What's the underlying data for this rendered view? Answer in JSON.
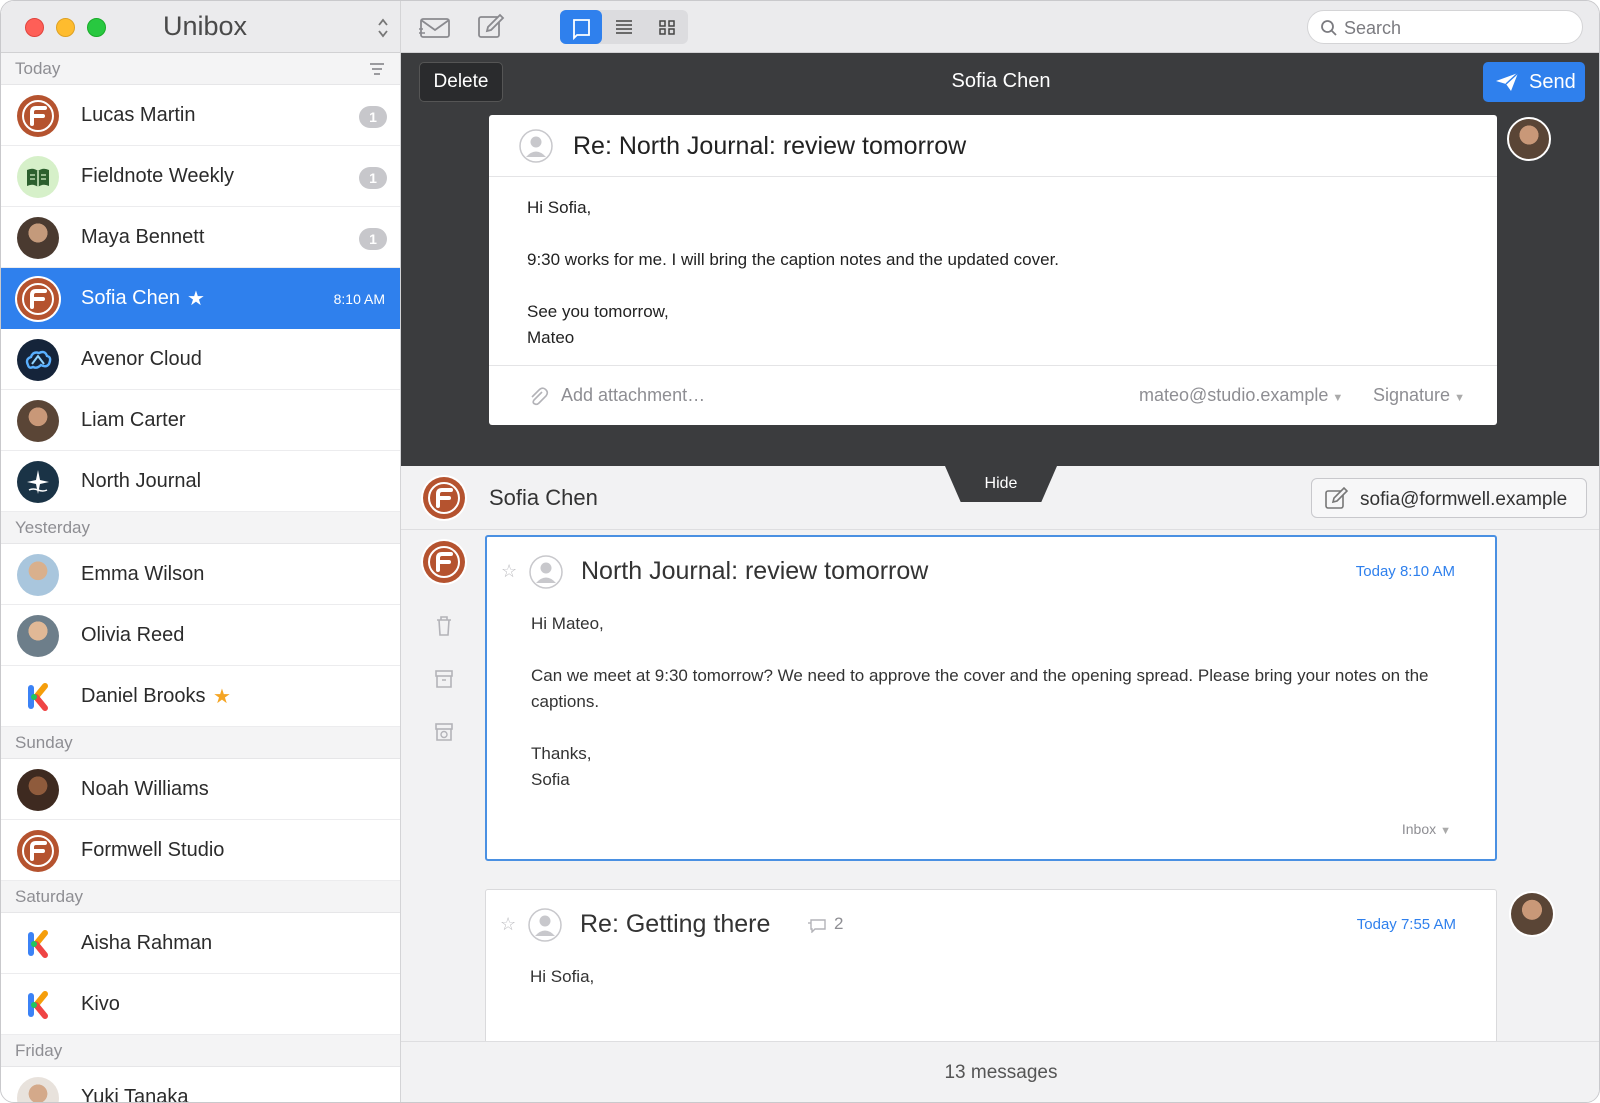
{
  "app": {
    "title": "Unibox"
  },
  "sidebar": {
    "sections": [
      {
        "label": "Today"
      },
      {
        "label": "Yesterday"
      },
      {
        "label": "Sunday"
      },
      {
        "label": "Saturday"
      },
      {
        "label": "Friday"
      }
    ],
    "contacts": [
      {
        "name": "Lucas Martin",
        "badge": "1"
      },
      {
        "name": "Fieldnote Weekly",
        "badge": "1"
      },
      {
        "name": "Maya Bennett",
        "badge": "1"
      },
      {
        "name": "Sofia Chen",
        "time": "8:10 AM",
        "starred": true,
        "selected": true
      },
      {
        "name": "Avenor Cloud"
      },
      {
        "name": "Liam Carter"
      },
      {
        "name": "North Journal"
      },
      {
        "name": "Emma Wilson"
      },
      {
        "name": "Olivia Reed"
      },
      {
        "name": "Daniel Brooks",
        "starred": true
      },
      {
        "name": "Noah Williams"
      },
      {
        "name": "Formwell Studio"
      },
      {
        "name": "Aisha Rahman"
      },
      {
        "name": "Kivo"
      },
      {
        "name": "Yuki Tanaka"
      }
    ]
  },
  "toolbar": {
    "search_placeholder": "Search",
    "accent": "#2f80ed"
  },
  "compose": {
    "delete_label": "Delete",
    "title": "Sofia Chen",
    "send_label": "Send",
    "subject": "Re: North Journal: review tomorrow",
    "body": [
      "Hi Sofia,",
      "",
      "9:30 works for me. I will bring the caption notes and the updated cover.",
      "",
      "See you tomorrow,",
      "Mateo"
    ],
    "attachment_placeholder": "Add attachment…",
    "from": "mateo@studio.example",
    "signature": "Signature"
  },
  "thread": {
    "contact_name": "Sofia Chen",
    "hide_label": "Hide",
    "contact_email": "sofia@formwell.example",
    "messages": [
      {
        "subject": "North Journal: review tomorrow",
        "time": "Today 8:10 AM",
        "body": [
          "Hi Mateo,",
          "",
          "Can we meet at 9:30 tomorrow? We need to approve the cover and the opening spread. Please bring your notes on the captions.",
          "",
          "Thanks,",
          "Sofia"
        ],
        "folder": "Inbox"
      },
      {
        "subject": "Re: Getting there",
        "time": "Today 7:55 AM",
        "count": "2",
        "body": [
          "Hi Sofia,"
        ]
      }
    ],
    "status": "13 messages"
  }
}
